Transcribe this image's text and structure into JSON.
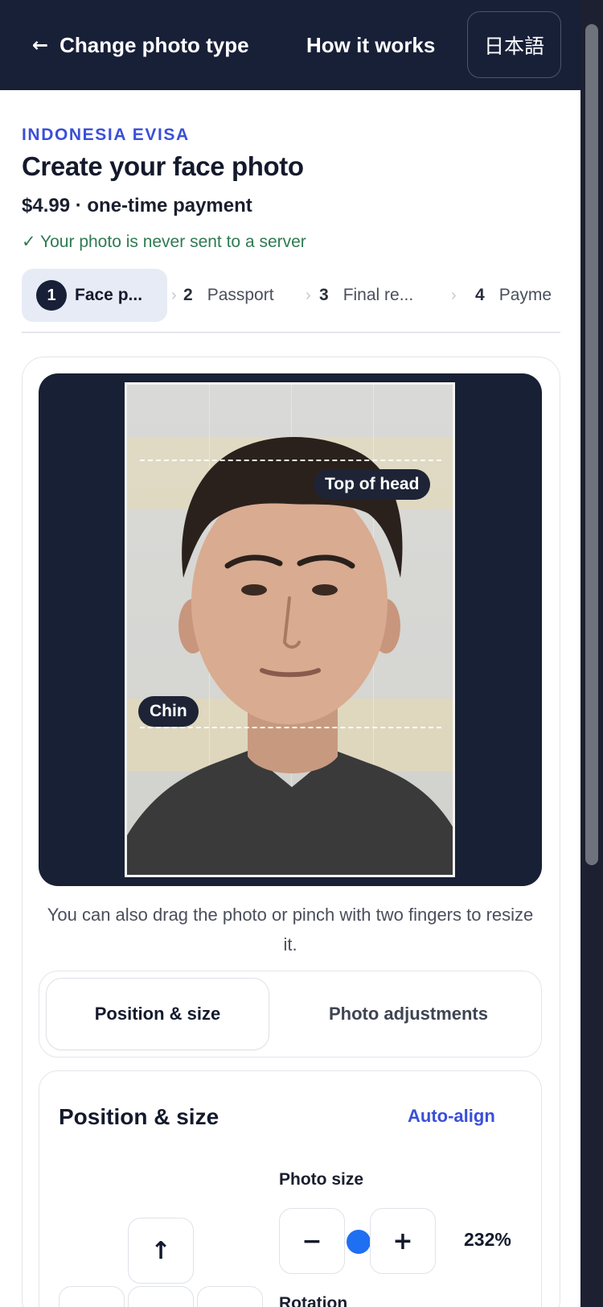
{
  "nav": {
    "back_arrow": "←",
    "back_label": "Change photo type",
    "how_it_works": "How it works",
    "language": "日本語"
  },
  "header": {
    "country": "INDONESIA EVISA",
    "title": "Create your face photo",
    "price": "$4.99 · one-time payment",
    "privacy": "✓ Your photo is never sent to a server"
  },
  "steps": [
    {
      "num": "1",
      "label": "Face p..."
    },
    {
      "num": "2",
      "label": "Passport"
    },
    {
      "num": "3",
      "label": "Final re..."
    },
    {
      "num": "4",
      "label": "Payme"
    }
  ],
  "editor": {
    "top_guide_label": "Top of head",
    "chin_guide_label": "Chin",
    "hint": "You can also drag the photo or pinch with two fingers to resize it."
  },
  "tabs": {
    "active": "Position & size",
    "other": "Photo adjustments"
  },
  "panel": {
    "title": "Position & size",
    "auto_align": "Auto-align",
    "photo_size_label": "Photo size",
    "minus": "−",
    "plus": "+",
    "zoom_percent": "232%",
    "up_arrow": "↑",
    "rotation_label": "Rotation"
  },
  "colors": {
    "navy": "#182038",
    "accent_blue": "#3a4fd8",
    "success_green": "#2f7a52",
    "slider_blue": "#1f6ff2"
  }
}
